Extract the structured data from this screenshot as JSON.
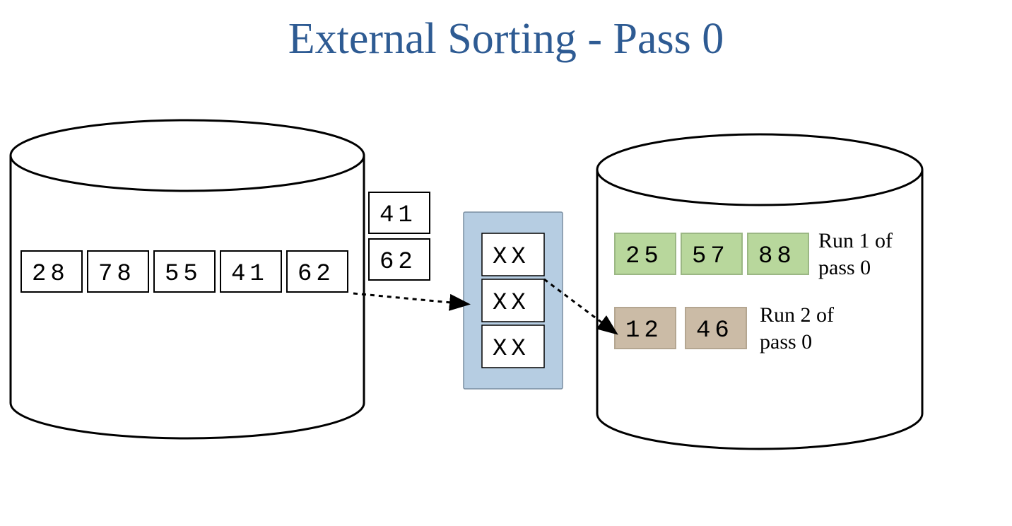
{
  "title": "External Sorting - Pass 0",
  "input_disk": {
    "pages": [
      "28",
      "78",
      "55",
      "41",
      "62"
    ]
  },
  "in_flight": {
    "pages": [
      "41",
      "62"
    ]
  },
  "buffer": {
    "slots": [
      "XX",
      "XX",
      "XX"
    ]
  },
  "output_disk": {
    "runs": [
      {
        "label_lines": [
          "Run 1 of",
          "pass 0"
        ],
        "pages": [
          "25",
          "57",
          "88"
        ]
      },
      {
        "label_lines": [
          "Run 2 of",
          "pass 0"
        ],
        "pages": [
          "12",
          "46"
        ]
      }
    ]
  }
}
